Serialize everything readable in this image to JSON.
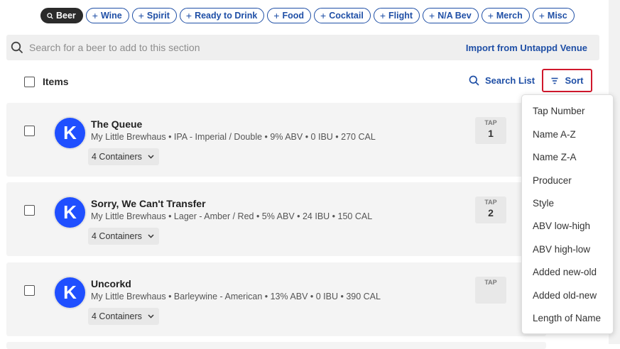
{
  "filters": {
    "active": "Beer",
    "items": [
      "Wine",
      "Spirit",
      "Ready to Drink",
      "Food",
      "Cocktail",
      "Flight",
      "N/A Bev",
      "Merch",
      "Misc"
    ]
  },
  "search": {
    "placeholder": "Search for a beer to add to this section",
    "import_label": "Import from Untappd Venue"
  },
  "list_header": {
    "items_label": "Items",
    "search_list_label": "Search List",
    "sort_label": "Sort"
  },
  "rows": [
    {
      "avatar_letter": "K",
      "name": "The Queue",
      "meta": "My Little Brewhaus • IPA - Imperial / Double • 9% ABV • 0 IBU • 270 CAL",
      "containers": "4 Containers",
      "tap_label": "TAP",
      "tap_number": "1"
    },
    {
      "avatar_letter": "K",
      "name": "Sorry, We Can't Transfer",
      "meta": "My Little Brewhaus • Lager - Amber / Red • 5% ABV • 24 IBU • 150 CAL",
      "containers": "4 Containers",
      "tap_label": "TAP",
      "tap_number": "2"
    },
    {
      "avatar_letter": "K",
      "name": "Uncorkd",
      "meta": "My Little Brewhaus • Barleywine - American • 13% ABV • 0 IBU • 390 CAL",
      "containers": "4 Containers",
      "tap_label": "TAP",
      "tap_number": ""
    }
  ],
  "sort_menu": [
    "Tap Number",
    "Name A-Z",
    "Name Z-A",
    "Producer",
    "Style",
    "ABV low-high",
    "ABV high-low",
    "Added new-old",
    "Added old-new",
    "Length of Name"
  ],
  "colors": {
    "accent": "#1f4fa6",
    "avatar": "#1f4fff",
    "highlight_border": "#d0182c",
    "active_pill": "#2b2b2b"
  },
  "icons": {
    "search": "search-icon",
    "sort": "sort-lines-icon",
    "chevron": "chevron-down-icon",
    "plus": "plus-icon"
  }
}
